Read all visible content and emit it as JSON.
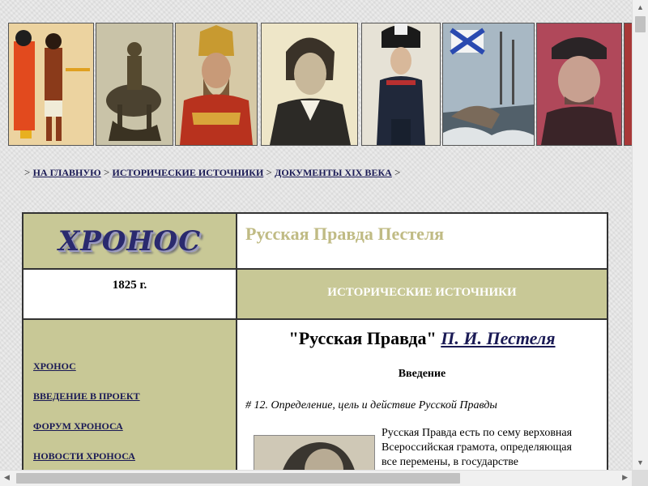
{
  "breadcrumb": {
    "sep": ">",
    "items": [
      "НА ГЛАВНУЮ",
      "ИСТОРИЧЕСКИЕ ИСТОЧНИКИ",
      "ДОКУМЕНТЫ XIX ВЕКА"
    ]
  },
  "logo": {
    "text": "ХРОНОС"
  },
  "page_title": "Русская Правда Пестеля",
  "year": "1825 г.",
  "section_title": "ИСТОРИЧЕСКИЕ ИСТОЧНИКИ",
  "menu": {
    "items": [
      "ХРОНОС",
      "ВВЕДЕНИЕ В ПРОЕКТ",
      "ФОРУМ ХРОНОСА",
      "НОВОСТИ ХРОНОСА"
    ]
  },
  "document": {
    "title_prefix": "\"Русская Правда\"",
    "author": "П. И. Пестеля",
    "intro": "Введение",
    "paragraph_title": "# 12. Определение, цель и действие Русской Правды",
    "body_lines": [
      "Русская Правда есть по сему верховная",
      "Всероссийская грамота, определяющая",
      "все перемены, в государстве"
    ]
  },
  "colors": {
    "olive": "#c8c896",
    "title_olive": "#c0bb84",
    "link": "#1a1a55"
  },
  "banner": {
    "images": [
      "egyptian-fresco",
      "horseman-statue",
      "tsar-portrait",
      "napoleon-portrait",
      "officer-portrait",
      "naval-flag-ship",
      "man-in-cap-portrait"
    ]
  }
}
